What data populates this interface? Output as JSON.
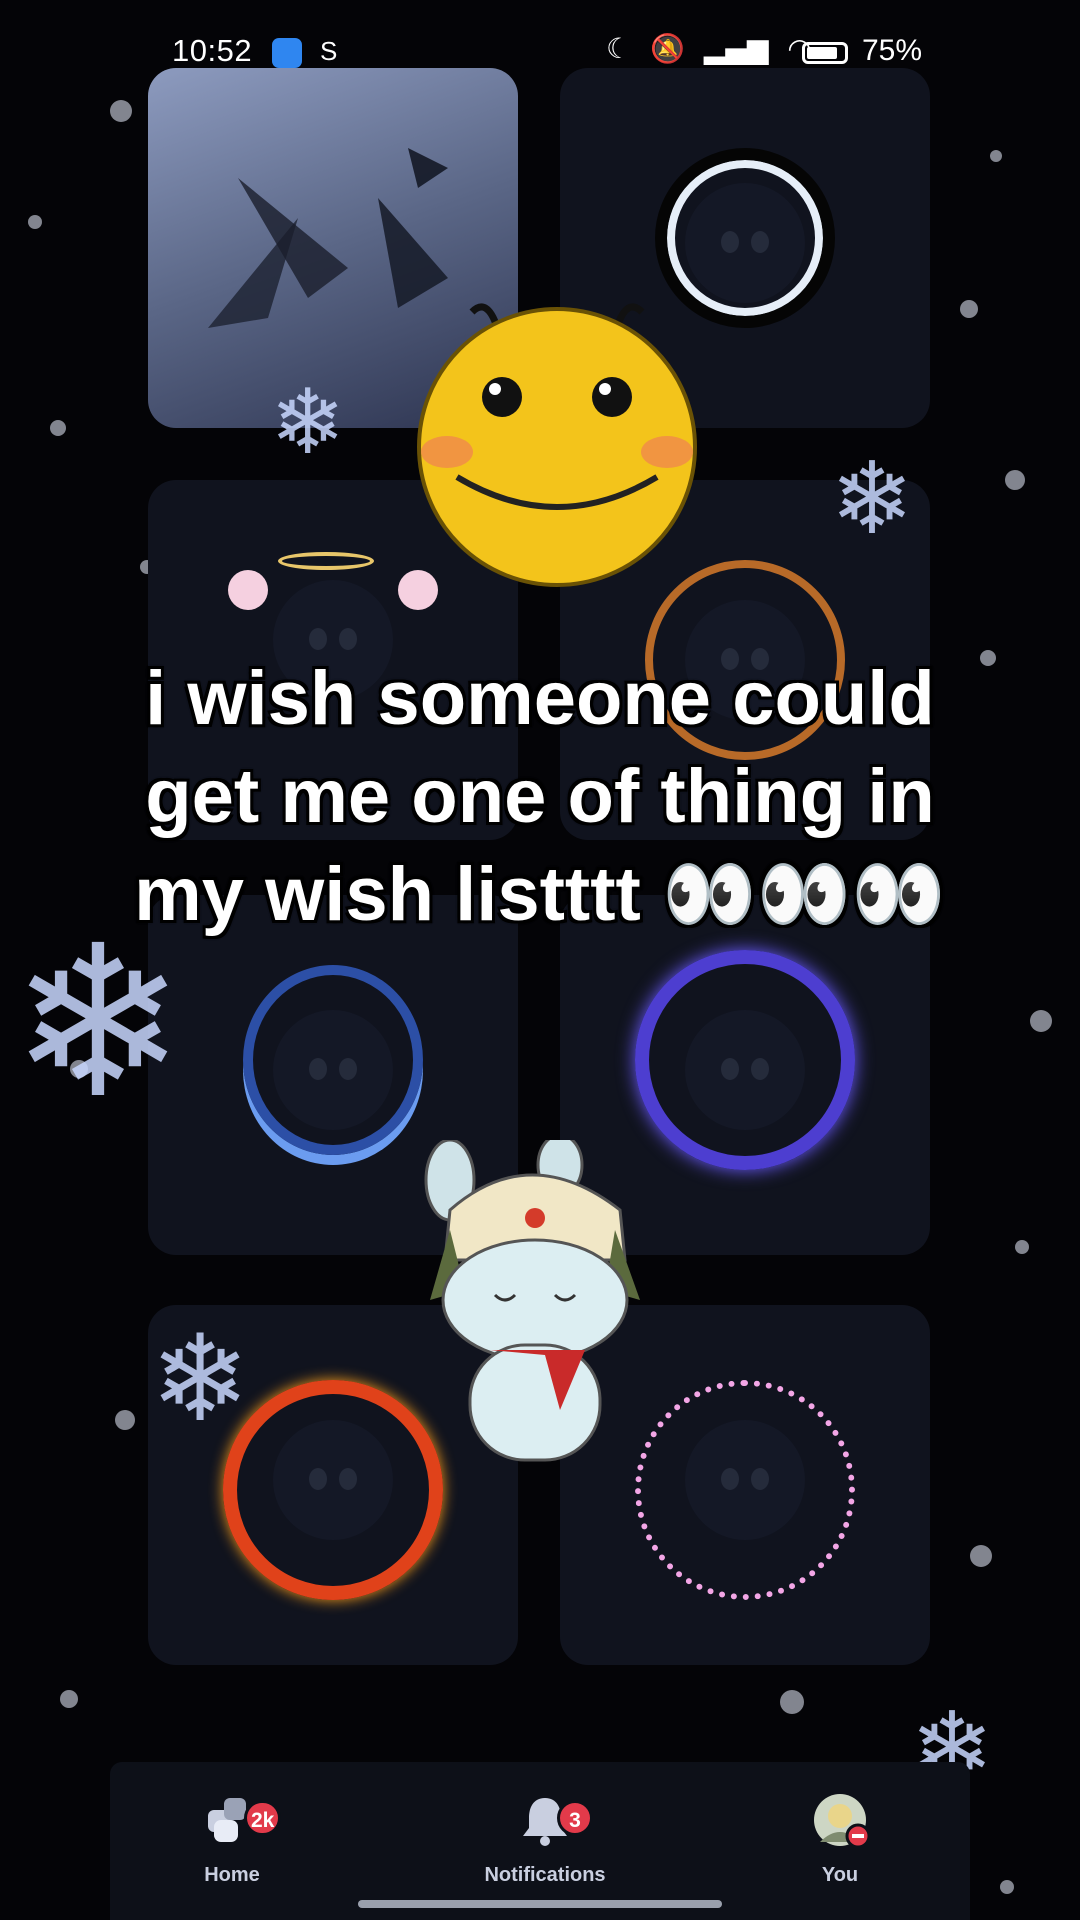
{
  "status_bar": {
    "time": "10:52",
    "notif_letter": "S",
    "battery": "75%"
  },
  "caption": {
    "lines": [
      "i wish someone could",
      "get me one of thing in",
      "my wish listttt 👀👀👀"
    ]
  },
  "grid": {
    "items": [
      "avatar-decoration-1",
      "avatar-decoration-2",
      "avatar-decoration-3",
      "avatar-decoration-4",
      "avatar-decoration-5",
      "avatar-decoration-6",
      "avatar-decoration-7",
      "avatar-decoration-8"
    ]
  },
  "nav": {
    "home": {
      "label": "Home",
      "badge": "2k"
    },
    "notifications": {
      "label": "Notifications",
      "badge": "3"
    },
    "you": {
      "label": "You"
    }
  }
}
